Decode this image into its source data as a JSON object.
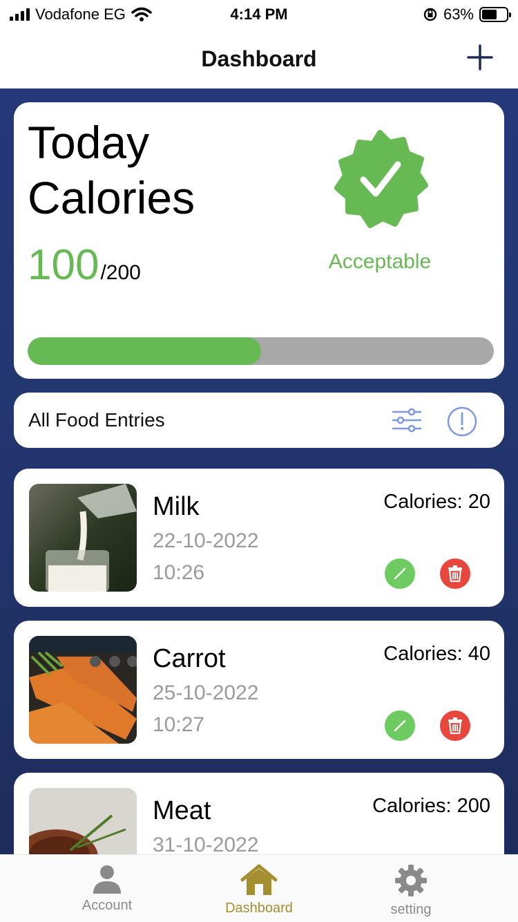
{
  "status_bar": {
    "carrier": "Vodafone EG",
    "time": "4:14 PM",
    "battery_percent": "63%",
    "battery_level": 0.63
  },
  "nav": {
    "title": "Dashboard",
    "add_icon": "plus-icon"
  },
  "summary": {
    "title_line1": "Today",
    "title_line2": "Calories",
    "current": "100",
    "total": "/200",
    "status": "Acceptable",
    "status_icon": "verified-badge-icon",
    "progress_fraction": 0.5,
    "accent_color": "#67b953",
    "track_color": "#a8a8a8"
  },
  "entries_header": {
    "label": "All Food Entries",
    "filter_icon": "sliders-icon",
    "info_icon": "info-icon"
  },
  "food_entries": [
    {
      "name": "Milk",
      "date": "22-10-2022",
      "time": "10:26",
      "calories": "Calories: 20",
      "image": "milk-photo"
    },
    {
      "name": "Carrot",
      "date": "25-10-2022",
      "time": "10:27",
      "calories": "Calories: 40",
      "image": "carrot-photo"
    },
    {
      "name": "Meat",
      "date": "31-10-2022",
      "time": "",
      "calories": "Calories: 200",
      "image": "meat-photo"
    }
  ],
  "tabs": [
    {
      "label": "Account",
      "icon": "person-icon",
      "active": false
    },
    {
      "label": "Dashboard",
      "icon": "home-icon",
      "active": true
    },
    {
      "label": "setting",
      "icon": "gear-icon",
      "active": false
    }
  ],
  "colors": {
    "background_navy": "#25397a",
    "edit_green": "#6dcb62",
    "delete_red": "#e8473d",
    "active_tab": "#a58e2f"
  }
}
